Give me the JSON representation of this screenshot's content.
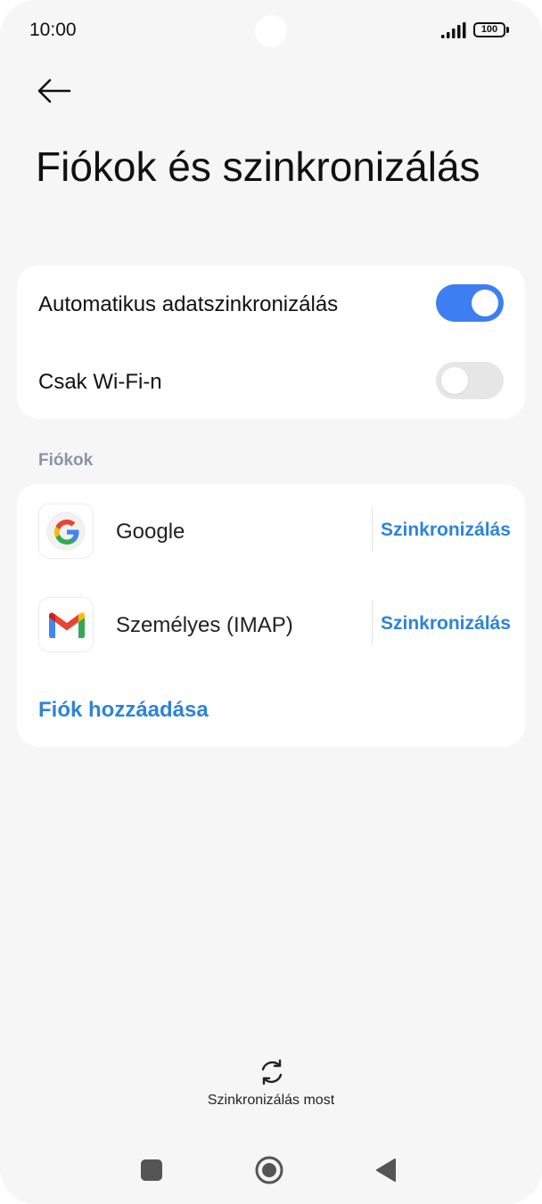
{
  "status_bar": {
    "time": "10:00",
    "battery": "100",
    "signal_icon": "signal-bars-icon"
  },
  "header": {
    "back_icon": "arrow-left-icon",
    "title": "Fiókok és szinkronizálás"
  },
  "sync_settings": {
    "auto_sync": {
      "label": "Automatikus adatszinkronizálás",
      "enabled": true
    },
    "wifi_only": {
      "label": "Csak Wi-Fi-n",
      "enabled": false
    }
  },
  "accounts": {
    "section_label": "Fiókok",
    "items": [
      {
        "name": "Google",
        "icon": "google-icon",
        "action": "Szinkronizálás"
      },
      {
        "name": "Személyes (IMAP)",
        "icon": "gmail-icon",
        "action": "Szinkronizálás"
      }
    ],
    "add_label": "Fiók hozzáadása"
  },
  "sync_now": {
    "label": "Szinkronizálás most",
    "icon": "sync-icon"
  },
  "nav_bar": {
    "recent": "square-icon",
    "home": "circle-icon",
    "back": "triangle-back-icon"
  },
  "colors": {
    "accent": "#3d7ef2",
    "link": "#2d84d8",
    "background": "#f6f6f6",
    "section_label": "#8a93a8"
  }
}
